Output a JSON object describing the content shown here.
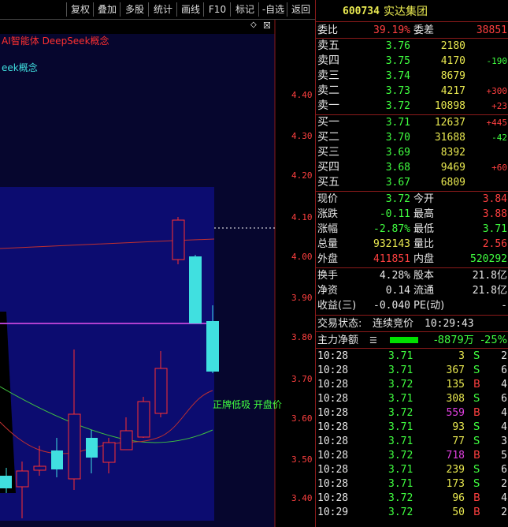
{
  "toolbar": {
    "buttons": [
      "复权",
      "叠加",
      "多股",
      "统计",
      "画线",
      "F10",
      "标记",
      "-自选",
      "返回"
    ]
  },
  "chart": {
    "indicator1": "AI智能体 DeepSeek概念",
    "indicator2": "eek概念",
    "price_ticks": [
      "4.40",
      "4.30",
      "4.20",
      "4.10",
      "4.00",
      "3.90",
      "3.80",
      "3.70",
      "3.60",
      "3.50",
      "3.40"
    ],
    "annotation": "正牌低吸 开盘价"
  },
  "stock": {
    "code": "600734",
    "name": "实达集团"
  },
  "weibi": {
    "label1": "委比",
    "value1": "39.19%",
    "label2": "委差",
    "value2": "38851"
  },
  "asks": [
    {
      "label": "卖五",
      "price": "3.76",
      "vol": "2180",
      "chg": ""
    },
    {
      "label": "卖四",
      "price": "3.75",
      "vol": "4170",
      "chg": "-190"
    },
    {
      "label": "卖三",
      "price": "3.74",
      "vol": "8679",
      "chg": ""
    },
    {
      "label": "卖二",
      "price": "3.73",
      "vol": "4217",
      "chg": "+300"
    },
    {
      "label": "卖一",
      "price": "3.72",
      "vol": "10898",
      "chg": "+23"
    }
  ],
  "bids": [
    {
      "label": "买一",
      "price": "3.71",
      "vol": "12637",
      "chg": "+445"
    },
    {
      "label": "买二",
      "price": "3.70",
      "vol": "31688",
      "chg": "-42"
    },
    {
      "label": "买三",
      "price": "3.69",
      "vol": "8392",
      "chg": ""
    },
    {
      "label": "买四",
      "price": "3.68",
      "vol": "9469",
      "chg": "+60"
    },
    {
      "label": "买五",
      "price": "3.67",
      "vol": "6809",
      "chg": ""
    }
  ],
  "quote": [
    {
      "l1": "现价",
      "v1": "3.72",
      "l2": "今开",
      "v2": "3.84"
    },
    {
      "l1": "涨跌",
      "v1": "-0.11",
      "l2": "最高",
      "v2": "3.88"
    },
    {
      "l1": "涨幅",
      "v1": "-2.87%",
      "l2": "最低",
      "v2": "3.71"
    },
    {
      "l1": "总量",
      "v1": "932143",
      "l2": "量比",
      "v2": "2.56"
    },
    {
      "l1": "外盘",
      "v1": "411851",
      "l2": "内盘",
      "v2": "520292"
    }
  ],
  "fund": [
    {
      "l1": "换手",
      "v1": "4.28%",
      "l2": "股本",
      "v2": "21.8亿"
    },
    {
      "l1": "净资",
      "v1": "0.14",
      "l2": "流通",
      "v2": "21.8亿"
    },
    {
      "l1": "收益(三)",
      "v1": "-0.040",
      "l2": "PE(动)",
      "v2": "-"
    }
  ],
  "status": {
    "label": "交易状态:",
    "value": "连续竞价",
    "time": "10:29:43"
  },
  "main_flow": {
    "label": "主力净额",
    "value": "-8879万",
    "pct": "-25%"
  },
  "colors": {
    "up": "#ff4040",
    "down": "#40ff40",
    "border": "#8b1a1a",
    "chart_bg": "#0a0a3c",
    "band": "#5a1e8c"
  },
  "ticks": [
    {
      "time": "10:28",
      "price": "3.71",
      "vol": "3",
      "side": "S",
      "n": "2"
    },
    {
      "time": "10:28",
      "price": "3.71",
      "vol": "367",
      "side": "S",
      "n": "6"
    },
    {
      "time": "10:28",
      "price": "3.72",
      "vol": "135",
      "side": "B",
      "n": "4"
    },
    {
      "time": "10:28",
      "price": "3.71",
      "vol": "308",
      "side": "S",
      "n": "6"
    },
    {
      "time": "10:28",
      "price": "3.72",
      "vol": "559",
      "side": "B",
      "n": "4"
    },
    {
      "time": "10:28",
      "price": "3.71",
      "vol": "93",
      "side": "S",
      "n": "4"
    },
    {
      "time": "10:28",
      "price": "3.71",
      "vol": "77",
      "side": "S",
      "n": "3"
    },
    {
      "time": "10:28",
      "price": "3.72",
      "vol": "718",
      "side": "B",
      "n": "5"
    },
    {
      "time": "10:28",
      "price": "3.71",
      "vol": "239",
      "side": "S",
      "n": "6"
    },
    {
      "time": "10:28",
      "price": "3.71",
      "vol": "173",
      "side": "S",
      "n": "2"
    },
    {
      "time": "10:28",
      "price": "3.72",
      "vol": "96",
      "side": "B",
      "n": "4"
    },
    {
      "time": "10:29",
      "price": "3.72",
      "vol": "50",
      "side": "B",
      "n": "2"
    }
  ]
}
